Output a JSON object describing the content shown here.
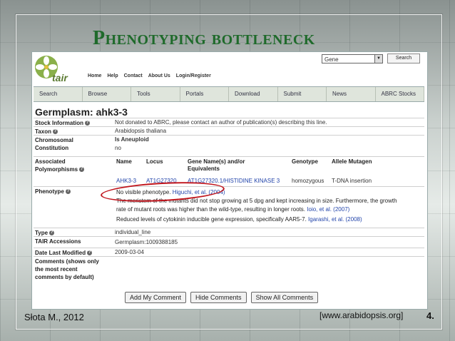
{
  "slide": {
    "title": "Phenotyping bottleneck",
    "citation": "Słota M., 2012",
    "source": "[www.arabidopsis.org]",
    "slide_number": "4."
  },
  "site": {
    "logo_text": "tair",
    "top_nav": [
      "Home",
      "Help",
      "Contact",
      "About Us",
      "Login/Register"
    ],
    "search_select": "Gene",
    "search_button": "Search",
    "main_nav": [
      "Search",
      "Browse",
      "Tools",
      "Portals",
      "Download",
      "Submit",
      "News",
      "ABRC Stocks"
    ]
  },
  "germplasm": {
    "title": "Germplasm: ahk3-3",
    "stock_label": "Stock Information",
    "stock_value": "Not donated to ABRC, please contact an author of publication(s) describing this line.",
    "taxon_label": "Taxon",
    "taxon_value": "Arabidopsis thaliana",
    "chromosomal_label": "Chromosomal Constitution",
    "aneuploid_label": "Is Aneuploid",
    "aneuploid_value": "no",
    "polymorphisms_label": "Associated Polymorphisms",
    "poly_headers": [
      "Name",
      "Locus",
      "Gene Name(s) and/or Equivalents",
      "Genotype",
      "Allele Mutagen"
    ],
    "poly_row": [
      "AHK3-3",
      "AT1G27320",
      "AT1G27320.1/HISTIDINE KINASE 3",
      "homozygous",
      "T-DNA insertion"
    ],
    "phenotype_label": "Phenotype",
    "phenotype_1_text": "No visible phenotype.",
    "phenotype_1_ref": "Higuchi, et al. (2004)",
    "phenotype_2_text_a": "The meristem of the mutants did not stop growing at 5 dpg and kept increasing in size. Furthermore, the growth",
    "phenotype_2_text_b": "rate of mutant roots was higher than the wild-type, resulting in longer roots.",
    "phenotype_2_ref": "Ioio, et al. (2007)",
    "phenotype_3_text": "Reduced levels of cytokinin inducible gene expression, specifically AAR5-7.",
    "phenotype_3_ref": "Igarashi, et al. (2008)",
    "type_label": "Type",
    "type_value": "individual_line",
    "tair_label": "TAIR Accessions",
    "tair_value": "Germplasm:1009388185",
    "date_label": "Date Last Modified",
    "date_value": "2009-03-04",
    "comments_label": "Comments (shows only the most recent comments by default)",
    "buttons": [
      "Add My Comment",
      "Hide Comments",
      "Show All Comments"
    ]
  },
  "colors": {
    "title_green": "#1f6a2b",
    "highlight_red": "#c0141c",
    "link_blue": "#2244aa"
  }
}
